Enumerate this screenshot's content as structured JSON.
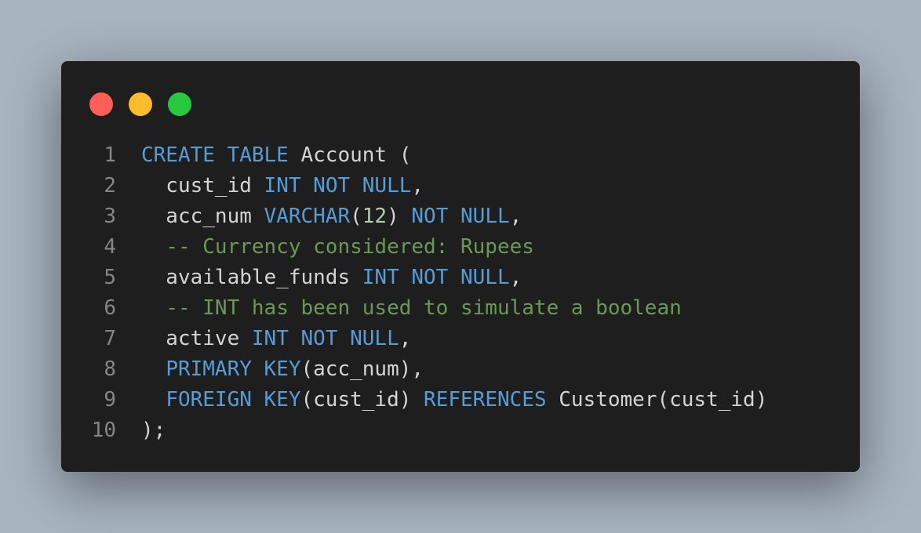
{
  "window": {
    "controls": [
      {
        "name": "close",
        "color": "#ff5f56"
      },
      {
        "name": "minimize",
        "color": "#ffbd2e"
      },
      {
        "name": "maximize",
        "color": "#27c93f"
      }
    ]
  },
  "editor": {
    "language": "sql",
    "lines": [
      {
        "number": "1",
        "tokens": [
          {
            "type": "keyword",
            "text": "CREATE TABLE"
          },
          {
            "type": "plain",
            "text": " Account ("
          }
        ]
      },
      {
        "number": "2",
        "tokens": [
          {
            "type": "plain",
            "text": "  cust_id "
          },
          {
            "type": "keyword",
            "text": "INT NOT NULL"
          },
          {
            "type": "plain",
            "text": ","
          }
        ]
      },
      {
        "number": "3",
        "tokens": [
          {
            "type": "plain",
            "text": "  acc_num "
          },
          {
            "type": "keyword",
            "text": "VARCHAR"
          },
          {
            "type": "plain",
            "text": "("
          },
          {
            "type": "number",
            "text": "12"
          },
          {
            "type": "plain",
            "text": ") "
          },
          {
            "type": "keyword",
            "text": "NOT NULL"
          },
          {
            "type": "plain",
            "text": ","
          }
        ]
      },
      {
        "number": "4",
        "tokens": [
          {
            "type": "plain",
            "text": "  "
          },
          {
            "type": "comment",
            "text": "-- Currency considered: Rupees"
          }
        ]
      },
      {
        "number": "5",
        "tokens": [
          {
            "type": "plain",
            "text": "  available_funds "
          },
          {
            "type": "keyword",
            "text": "INT NOT NULL"
          },
          {
            "type": "plain",
            "text": ","
          }
        ]
      },
      {
        "number": "6",
        "tokens": [
          {
            "type": "plain",
            "text": "  "
          },
          {
            "type": "comment",
            "text": "-- INT has been used to simulate a boolean"
          }
        ]
      },
      {
        "number": "7",
        "tokens": [
          {
            "type": "plain",
            "text": "  active "
          },
          {
            "type": "keyword",
            "text": "INT NOT NULL"
          },
          {
            "type": "plain",
            "text": ","
          }
        ]
      },
      {
        "number": "8",
        "tokens": [
          {
            "type": "plain",
            "text": "  "
          },
          {
            "type": "keyword",
            "text": "PRIMARY KEY"
          },
          {
            "type": "plain",
            "text": "(acc_num),"
          }
        ]
      },
      {
        "number": "9",
        "tokens": [
          {
            "type": "plain",
            "text": "  "
          },
          {
            "type": "keyword",
            "text": "FOREIGN KEY"
          },
          {
            "type": "plain",
            "text": "(cust_id) "
          },
          {
            "type": "keyword",
            "text": "REFERENCES"
          },
          {
            "type": "plain",
            "text": " Customer(cust_id)"
          }
        ]
      },
      {
        "number": "10",
        "tokens": [
          {
            "type": "plain",
            "text": ");"
          }
        ]
      }
    ]
  }
}
